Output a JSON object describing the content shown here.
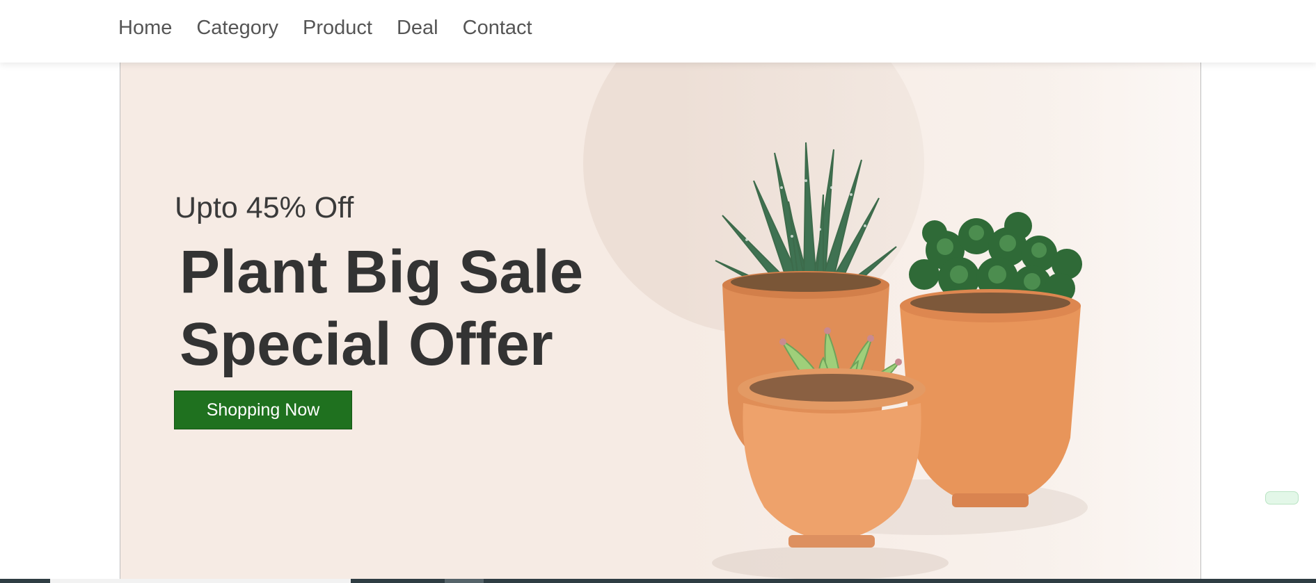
{
  "nav": {
    "items": [
      {
        "label": "Home"
      },
      {
        "label": "Category"
      },
      {
        "label": "Product"
      },
      {
        "label": "Deal"
      },
      {
        "label": "Contact"
      }
    ]
  },
  "hero": {
    "subtitle": "Upto 45% Off",
    "title_line1": "Plant Big Sale",
    "title_line2": "Special Offer",
    "button_label": "Shopping Now",
    "image_alt": "three succulent plants in terracotta pots"
  },
  "colors": {
    "button_bg": "#1f711f",
    "hero_bg": "#f6ebe4",
    "nav_text": "#555555",
    "title_text": "#333333",
    "pot": "#e8955a"
  }
}
